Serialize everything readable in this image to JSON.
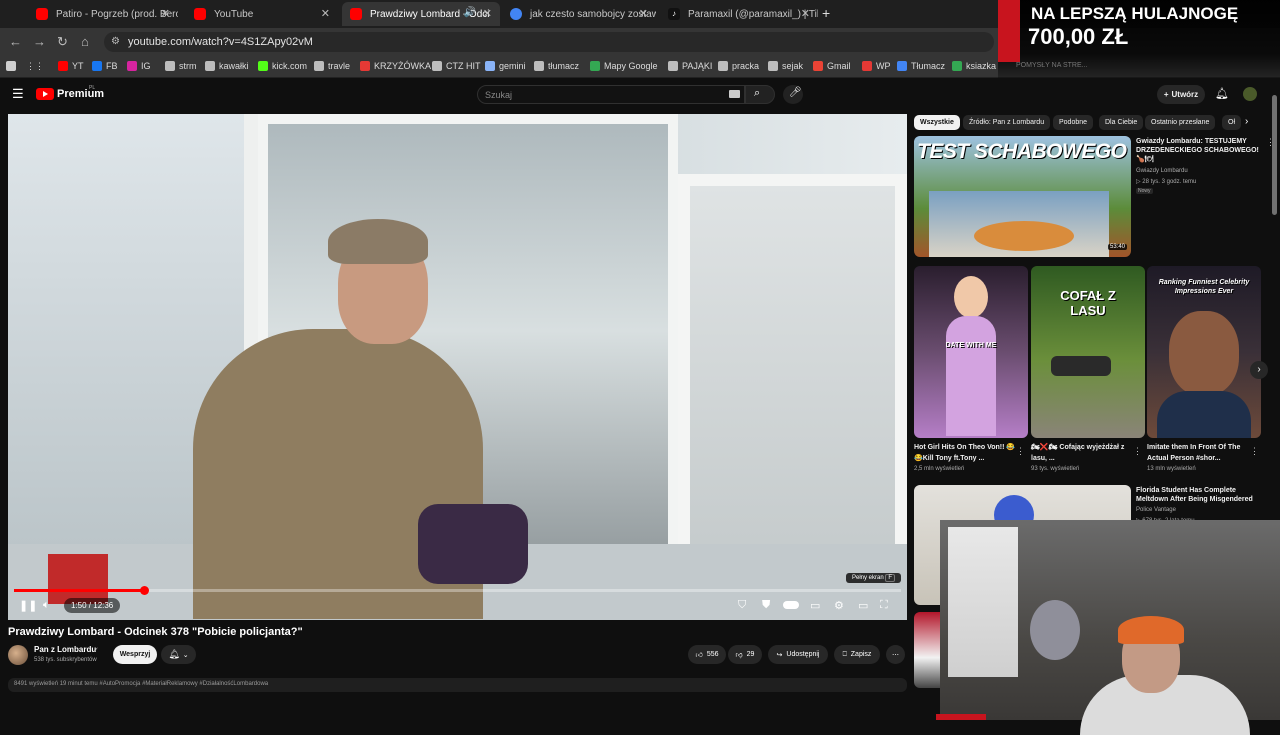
{
  "browser": {
    "tabs": [
      {
        "label": "Patiro - Pogrzeb (prod. Bero) - Y",
        "active": false,
        "favicon_color": "#ff0000"
      },
      {
        "label": "YouTube",
        "active": false,
        "favicon_color": "#ff0000"
      },
      {
        "label": "Prawdziwy Lombard - Odci",
        "active": true,
        "favicon_color": "#ff0000"
      },
      {
        "label": "jak czesto samobojcy zostawiaja",
        "active": false,
        "favicon_color": "#4285f4"
      },
      {
        "label": "Paramaxil (@paramaxil_) | TikTo",
        "active": false,
        "favicon_color": "#111111"
      }
    ],
    "new_tab": "+",
    "url": "youtube.com/watch?v=4S1ZApy02vM",
    "bookmarks": [
      {
        "label": "YT",
        "color": "#ff0000"
      },
      {
        "label": "FB",
        "color": "#1877f2"
      },
      {
        "label": "IG",
        "color": "#d6249f"
      },
      {
        "label": "strm",
        "color": "#bdbdbd"
      },
      {
        "label": "kawałki",
        "color": "#bdbdbd"
      },
      {
        "label": "kick.com",
        "color": "#53fc18"
      },
      {
        "label": "travle",
        "color": "#bdbdbd"
      },
      {
        "label": "KRZYŻÓWKA",
        "color": "#e53935"
      },
      {
        "label": "CTZ HIT",
        "color": "#bdbdbd"
      },
      {
        "label": "gemini",
        "color": "#8ab4f8"
      },
      {
        "label": "tłumacz",
        "color": "#bdbdbd"
      },
      {
        "label": "Mapy Google",
        "color": "#34a853"
      },
      {
        "label": "PAJĄKI",
        "color": "#bdbdbd"
      },
      {
        "label": "pracka",
        "color": "#bdbdbd"
      },
      {
        "label": "sejak",
        "color": "#bdbdbd"
      },
      {
        "label": "Gmail",
        "color": "#ea4335"
      },
      {
        "label": "WP",
        "color": "#e53935"
      },
      {
        "label": "Tłumacz",
        "color": "#4285f4"
      },
      {
        "label": "ksiazka",
        "color": "#34a853"
      }
    ]
  },
  "youtube": {
    "logo_text": "Premium",
    "logo_region": "PL",
    "search_placeholder": "Szukaj",
    "create_label": "Utwórz",
    "accent": "#ff0000"
  },
  "player": {
    "progress_fraction": 0.1464,
    "time": "1:50 / 12:36",
    "tooltip": "Pełny ekran",
    "tooltip_key": "F"
  },
  "video": {
    "title": "Prawdziwy Lombard - Odcinek 378 \"Pobicie policjanta?\"",
    "channel": "Pan z Lombardu",
    "subscribers": "538 tys. subskrybentów",
    "join_label": "Wesprzyj",
    "likes": "556",
    "dislikes": "29",
    "share_label": "Udostępnij",
    "save_label": "Zapisz",
    "description_preview": "8491 wyświetleń  19 minut temu  #AutoPromocja #MateriałReklamowy #DziałalnośćLombardowa"
  },
  "filters": [
    "Wszystkie",
    "Źródło: Pan z Lombardu",
    "Podobne",
    "Dla Ciebie",
    "Ostatnio przesłane",
    "Oł"
  ],
  "recommended": [
    {
      "thumb_text": "TEST SCHABOWEGO",
      "duration": "53:40",
      "title": "Gwiazdy Lombardu: TESTUJEMY DRZEDENECKIEGO SCHABOWEGO! 🍗🍽",
      "channel": "Gwiazdy Lombardu",
      "meta": "28 tys.  3 godz. temu",
      "badge": "Nowy"
    },
    {
      "title": "Florida Student Has Complete Meltdown After Being Misgendered",
      "channel": "Police Vantage",
      "meta": "678 tys.  2 lata temu"
    }
  ],
  "shorts": [
    {
      "overlay": "DATE WITH ME",
      "title": "Hot Girl Hits On Theo Von!! 😂😂Kill Tony ft.Tony ...",
      "views": "2,5 mln wyświetleń"
    },
    {
      "overlay": "COFAŁ Z LASU",
      "title": "🏍❌🏍 Cofając wyjeżdżał z lasu, ...",
      "views": "93 tys. wyświetleń"
    },
    {
      "overlay": "Ranking Funniest Celebrity Impressions Ever",
      "title": "Imitate them In Front Of The Actual Person #shor...",
      "views": "13 mln wyświetleń"
    }
  ],
  "promo": {
    "line1": "NA LEPSZĄ HULAJNOGĘ",
    "line2": "700,00 ZŁ",
    "sub": "POMYSŁY NA STRE..."
  }
}
